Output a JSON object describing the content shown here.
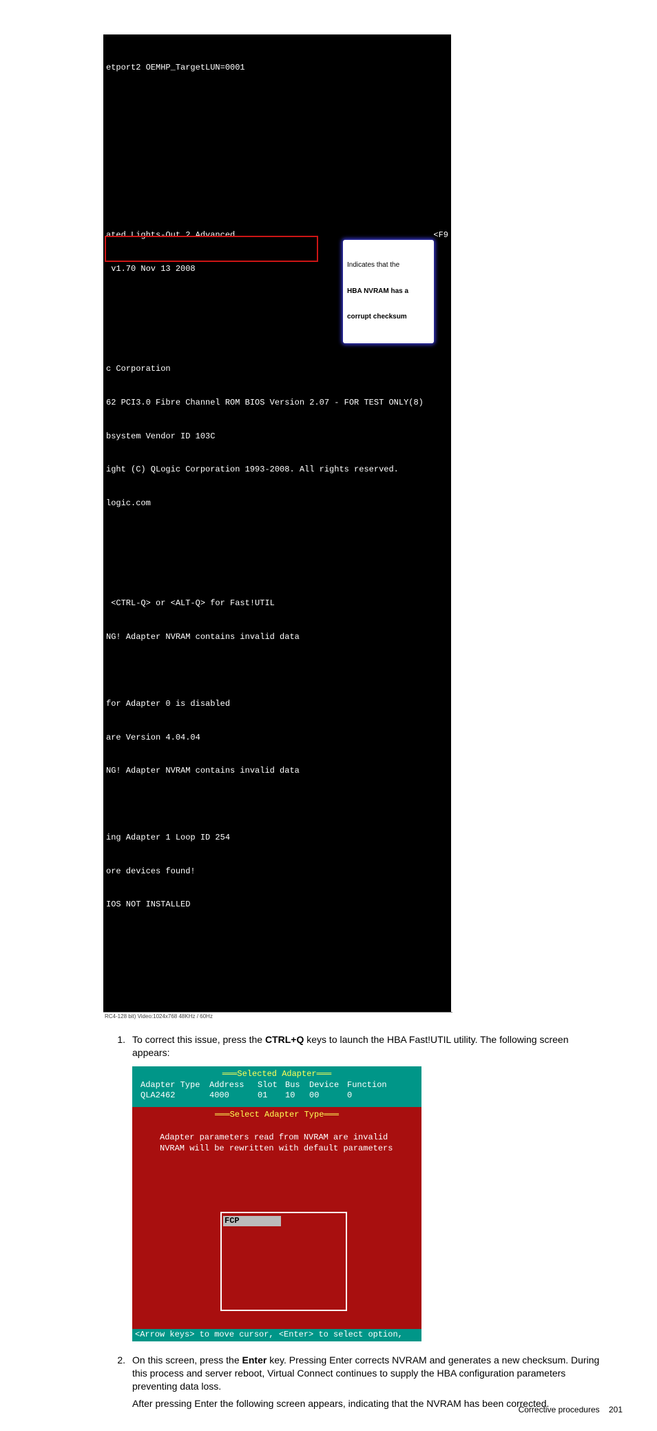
{
  "term1": {
    "l1": "etport2 OEMHP_TargetLUN=0001",
    "l2_left": "ated Lights-Out 2 Advanced",
    "l2_right": "<F9",
    "l3": " v1.70 Nov 13 2008",
    "l4": "c Corporation",
    "l5": "62 PCI3.0 Fibre Channel ROM BIOS Version 2.07 - FOR TEST ONLY(8)",
    "l6": "bsystem Vendor ID 103C",
    "l7": "ight (C) QLogic Corporation 1993-2008. All rights reserved.",
    "l8": "logic.com",
    "l9": " <CTRL-Q> or <ALT-Q> for Fast!UTIL",
    "l10": "NG! Adapter NVRAM contains invalid data",
    "l11": "for Adapter 0 is disabled",
    "l12": "are Version 4.04.04",
    "l13": "NG! Adapter NVRAM contains invalid data",
    "l14": "ing Adapter 1 Loop ID 254",
    "l15": "ore devices found!",
    "l16": "IOS NOT INSTALLED",
    "footer": "RC4-128 bit)  Video:1024x768  48KHz / 60Hz"
  },
  "callout": {
    "line1": "Indicates that the",
    "line2": "HBA NVRAM has a",
    "line3": "corrupt checksum"
  },
  "step1": {
    "num": "1.",
    "pre": "To correct this issue, press the ",
    "bold": "CTRL+Q",
    "post": " keys to launch the HBA Fast!UTIL utility. The following screen appears:"
  },
  "term2": {
    "title1": "Selected Adapter",
    "hdr": {
      "c1": "Adapter Type",
      "c2": "Address",
      "c3": "Slot",
      "c4": "Bus",
      "c5": "Device",
      "c6": "Function"
    },
    "val": {
      "c1": "QLA2462",
      "c2": "4000",
      "c3": "01",
      "c4": "10",
      "c5": "00",
      "c6": "0"
    },
    "title2": "Select Adapter Type",
    "msg1": "Adapter parameters read from NVRAM are invalid",
    "msg2": "NVRAM will be rewritten with default parameters",
    "fcp": "FCP",
    "foot": "<Arrow keys> to move cursor, <Enter> to select option,"
  },
  "step2": {
    "num": "2.",
    "pre": "On this screen, press the ",
    "bold": "Enter",
    "post": " key. Pressing Enter corrects NVRAM and generates a new checksum. During this process and server reboot, Virtual Connect continues to supply the HBA configuration parameters preventing data loss."
  },
  "after": "After pressing Enter the following screen appears, indicating that the NVRAM has been corrected.",
  "footer": {
    "section": "Corrective procedures",
    "page": "201"
  }
}
